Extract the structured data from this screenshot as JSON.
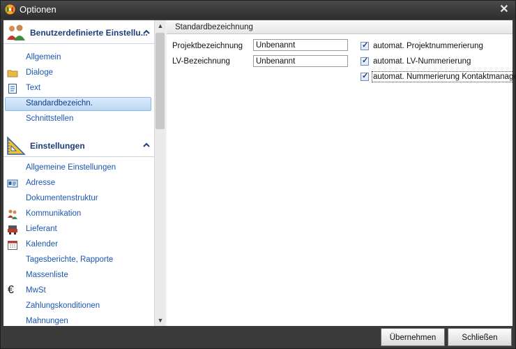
{
  "window": {
    "title": "Optionen"
  },
  "sidebar": {
    "groups": [
      {
        "label": "Benutzerdefinierte Einstellu...",
        "items": [
          {
            "label": "Allgemein",
            "icon": ""
          },
          {
            "label": "Dialoge",
            "icon": "folder-icon"
          },
          {
            "label": "Text",
            "icon": "text-document-icon"
          },
          {
            "label": "Standardbezeichn.",
            "icon": "",
            "selected": true
          },
          {
            "label": "Schnittstellen",
            "icon": ""
          }
        ]
      },
      {
        "label": "Einstellungen",
        "items": [
          {
            "label": "Allgemeine Einstellungen",
            "icon": ""
          },
          {
            "label": "Adresse",
            "icon": "address-card-icon"
          },
          {
            "label": "Dokumentenstruktur",
            "icon": ""
          },
          {
            "label": "Kommunikation",
            "icon": "people-icon"
          },
          {
            "label": "Lieferant",
            "icon": "supplier-icon"
          },
          {
            "label": "Kalender",
            "icon": "calendar-icon"
          },
          {
            "label": "Tagesberichte, Rapporte",
            "icon": ""
          },
          {
            "label": "Massenliste",
            "icon": ""
          },
          {
            "label": "MwSt",
            "icon": "euro-icon"
          },
          {
            "label": "Zahlungskonditionen",
            "icon": ""
          },
          {
            "label": "Mahnungen",
            "icon": ""
          }
        ]
      }
    ]
  },
  "content": {
    "header": "Standardbezeichnung",
    "fields": [
      {
        "label": "Projektbezeichnung",
        "value": "Unbenannt"
      },
      {
        "label": "LV-Bezeichnung",
        "value": "Unbenannt"
      }
    ],
    "checkboxes": [
      {
        "label": "automat. Projektnummerierung",
        "checked": true
      },
      {
        "label": "automat. LV-Nummerierung",
        "checked": true
      },
      {
        "label": "automat. Nummerierung Kontaktmanager",
        "checked": true
      }
    ]
  },
  "footer": {
    "apply_label": "Übernehmen",
    "close_label": "Schließen"
  },
  "colors": {
    "accent": "#1b56b0",
    "selection": "#bcd8f5",
    "chrome": "#3a3a3a"
  }
}
